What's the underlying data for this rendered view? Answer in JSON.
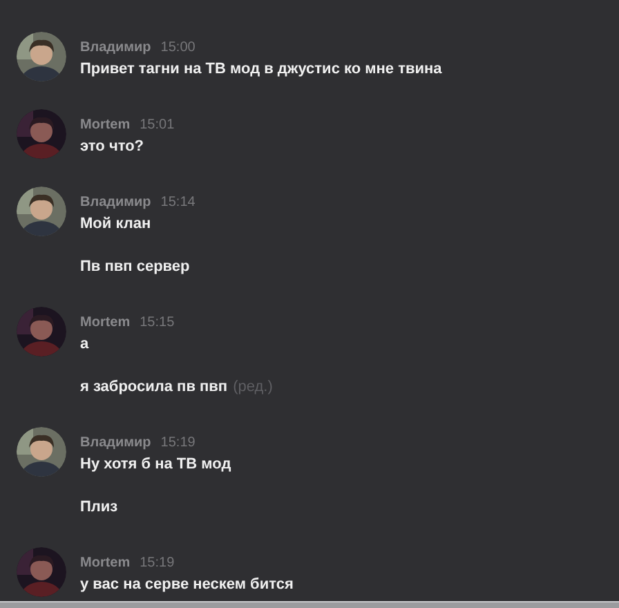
{
  "groups": [
    {
      "author": "Владимир",
      "time": "15:00",
      "kind": "light",
      "messages": [
        {
          "text": "Привет тагни на ТВ мод в джустис ко мне твина"
        }
      ]
    },
    {
      "author": "Mortem",
      "time": "15:01",
      "kind": "dark",
      "messages": [
        {
          "text": "это что?"
        }
      ]
    },
    {
      "author": "Владимир",
      "time": "15:14",
      "kind": "light",
      "messages": [
        {
          "text": "Мой клан"
        },
        {
          "text": "Пв пвп сервер"
        }
      ]
    },
    {
      "author": "Mortem",
      "time": "15:15",
      "kind": "dark",
      "messages": [
        {
          "text": "а"
        },
        {
          "text": "я забросила пв пвп",
          "edited_label": "(ред.)"
        }
      ]
    },
    {
      "author": "Владимир",
      "time": "15:19",
      "kind": "light",
      "messages": [
        {
          "text": "Ну хотя б на ТВ мод"
        },
        {
          "text": "Плиз"
        }
      ]
    },
    {
      "author": "Mortem",
      "time": "15:19",
      "kind": "dark",
      "messages": [
        {
          "text": "у вас на серве нескем бится"
        }
      ]
    }
  ]
}
